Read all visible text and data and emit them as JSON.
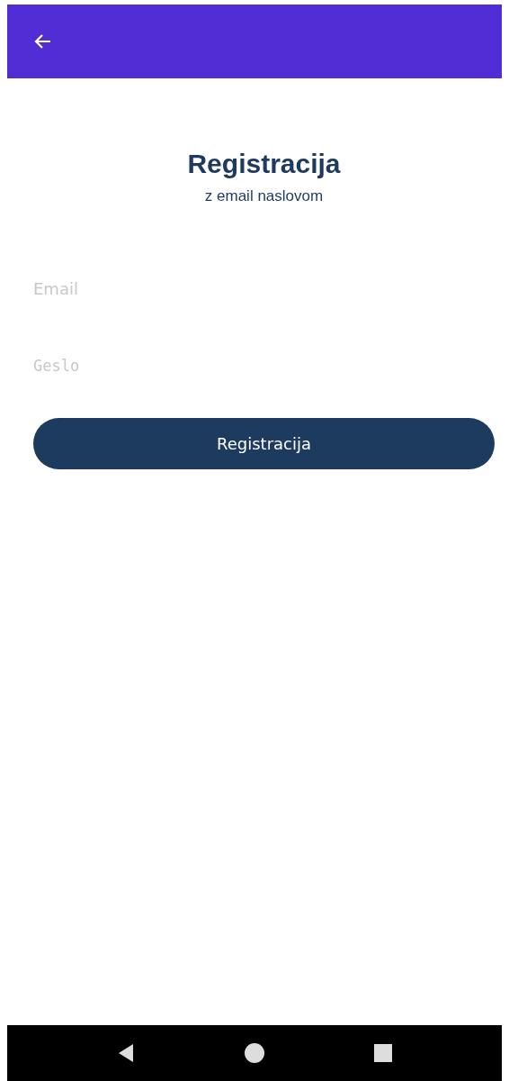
{
  "heading": {
    "title": "Registracija",
    "subtitle": "z email naslovom"
  },
  "fields": [
    {
      "kind": "text",
      "placeholder": "Email"
    },
    {
      "kind": "password",
      "placeholder": "Geslo"
    }
  ],
  "submit_button": {
    "label": "Registracija"
  }
}
